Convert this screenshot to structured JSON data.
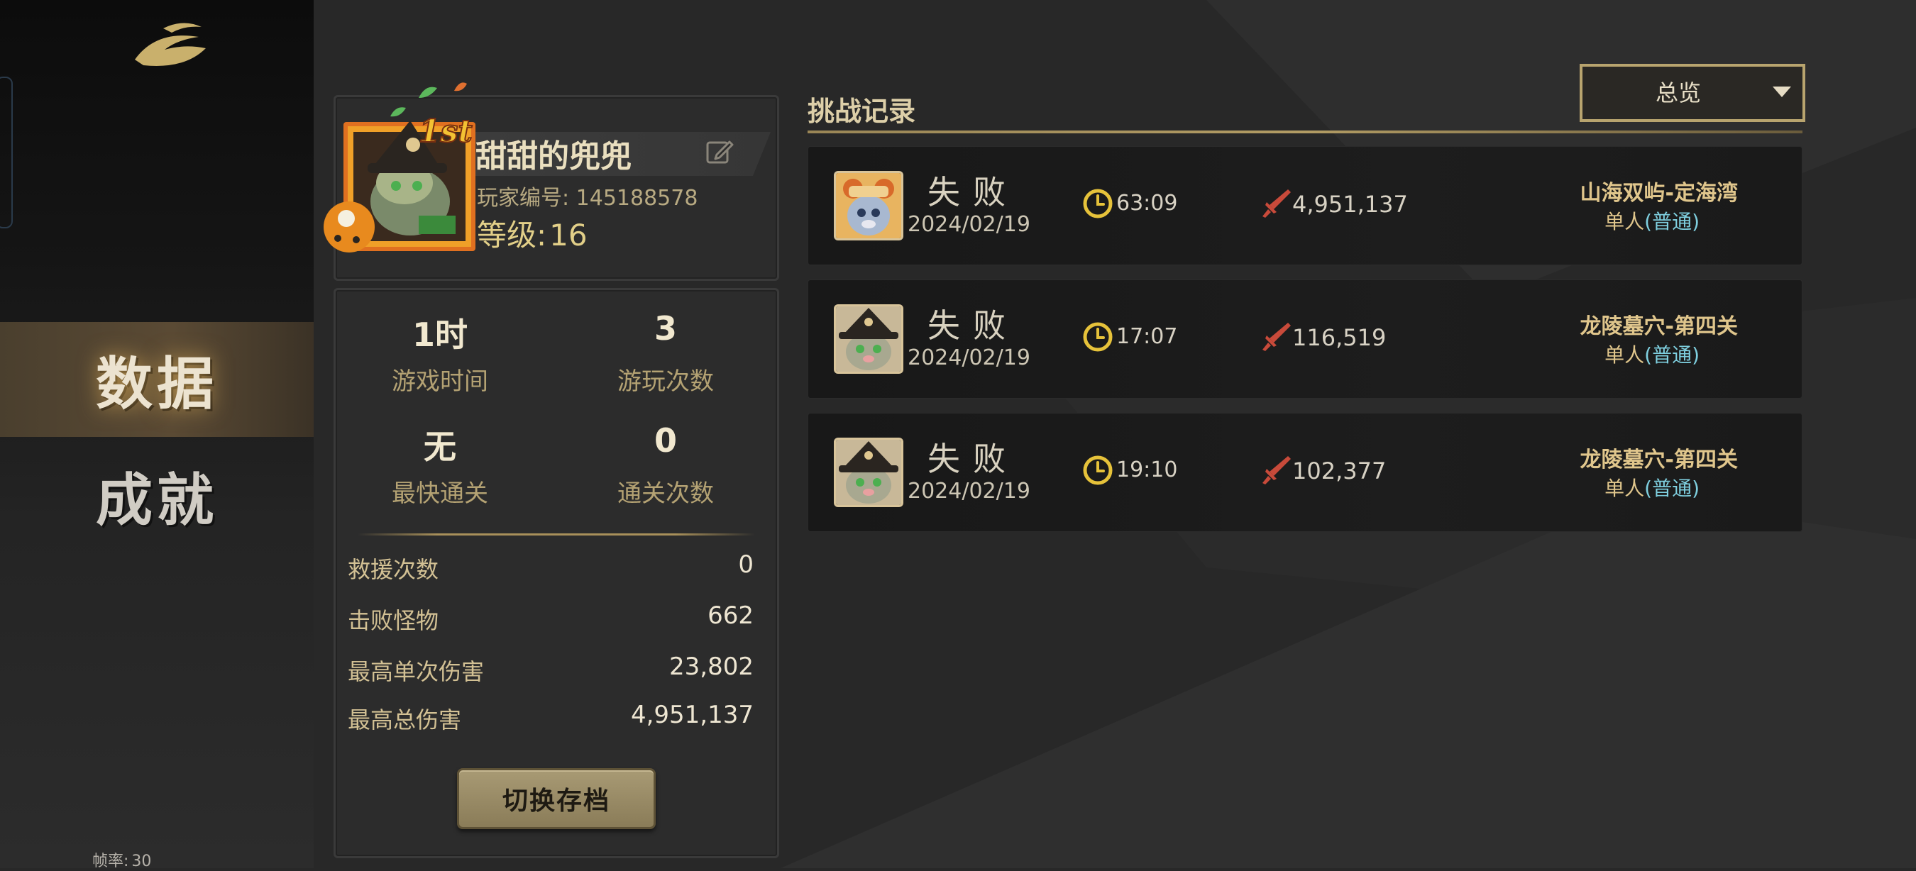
{
  "sidebar": {
    "items": [
      {
        "label": "数据",
        "active": true
      },
      {
        "label": "成就",
        "active": false
      }
    ],
    "fps_label": "帧率:",
    "fps_value": "30"
  },
  "profile": {
    "name": "甜甜的兜兜",
    "rank_badge": "1st",
    "id_label": "玩家编号:",
    "id_value": "145188578",
    "level_label": "等级:",
    "level_value": "16"
  },
  "stats": {
    "play_time": {
      "value": "1时",
      "label": "游戏时间"
    },
    "play_count": {
      "value": "3",
      "label": "游玩次数"
    },
    "fastest_clear": {
      "value": "无",
      "label": "最快通关"
    },
    "clear_count": {
      "value": "0",
      "label": "通关次数"
    },
    "rows": [
      {
        "label": "救援次数",
        "value": "0"
      },
      {
        "label": "击败怪物",
        "value": "662"
      },
      {
        "label": "最高单次伤害",
        "value": "23,802"
      },
      {
        "label": "最高总伤害",
        "value": "4,951,137"
      }
    ],
    "switch_button": "切换存档"
  },
  "records": {
    "title": "挑战记录",
    "filter": {
      "selected": "总览"
    },
    "items": [
      {
        "result": "失败",
        "date": "2024/02/19",
        "duration": "63:09",
        "damage": "4,951,137",
        "stage": "山海双屿-定海湾",
        "mode": "单人",
        "difficulty": "(普通)",
        "avatar": "cat-mouse-avatar"
      },
      {
        "result": "失败",
        "date": "2024/02/19",
        "duration": "17:07",
        "damage": "116,519",
        "stage": "龙陵墓穴-第四关",
        "mode": "单人",
        "difficulty": "(普通)",
        "avatar": "witch-cat-avatar"
      },
      {
        "result": "失败",
        "date": "2024/02/19",
        "duration": "19:10",
        "damage": "102,377",
        "stage": "龙陵墓穴-第四关",
        "mode": "单人",
        "difficulty": "(普通)",
        "avatar": "witch-cat-avatar"
      }
    ]
  },
  "colors": {
    "accent_gold": "#b8a46e",
    "difficulty_cyan": "#7fd0e0",
    "damage_red": "#c84a3a",
    "clock_yellow": "#e6c23a"
  }
}
